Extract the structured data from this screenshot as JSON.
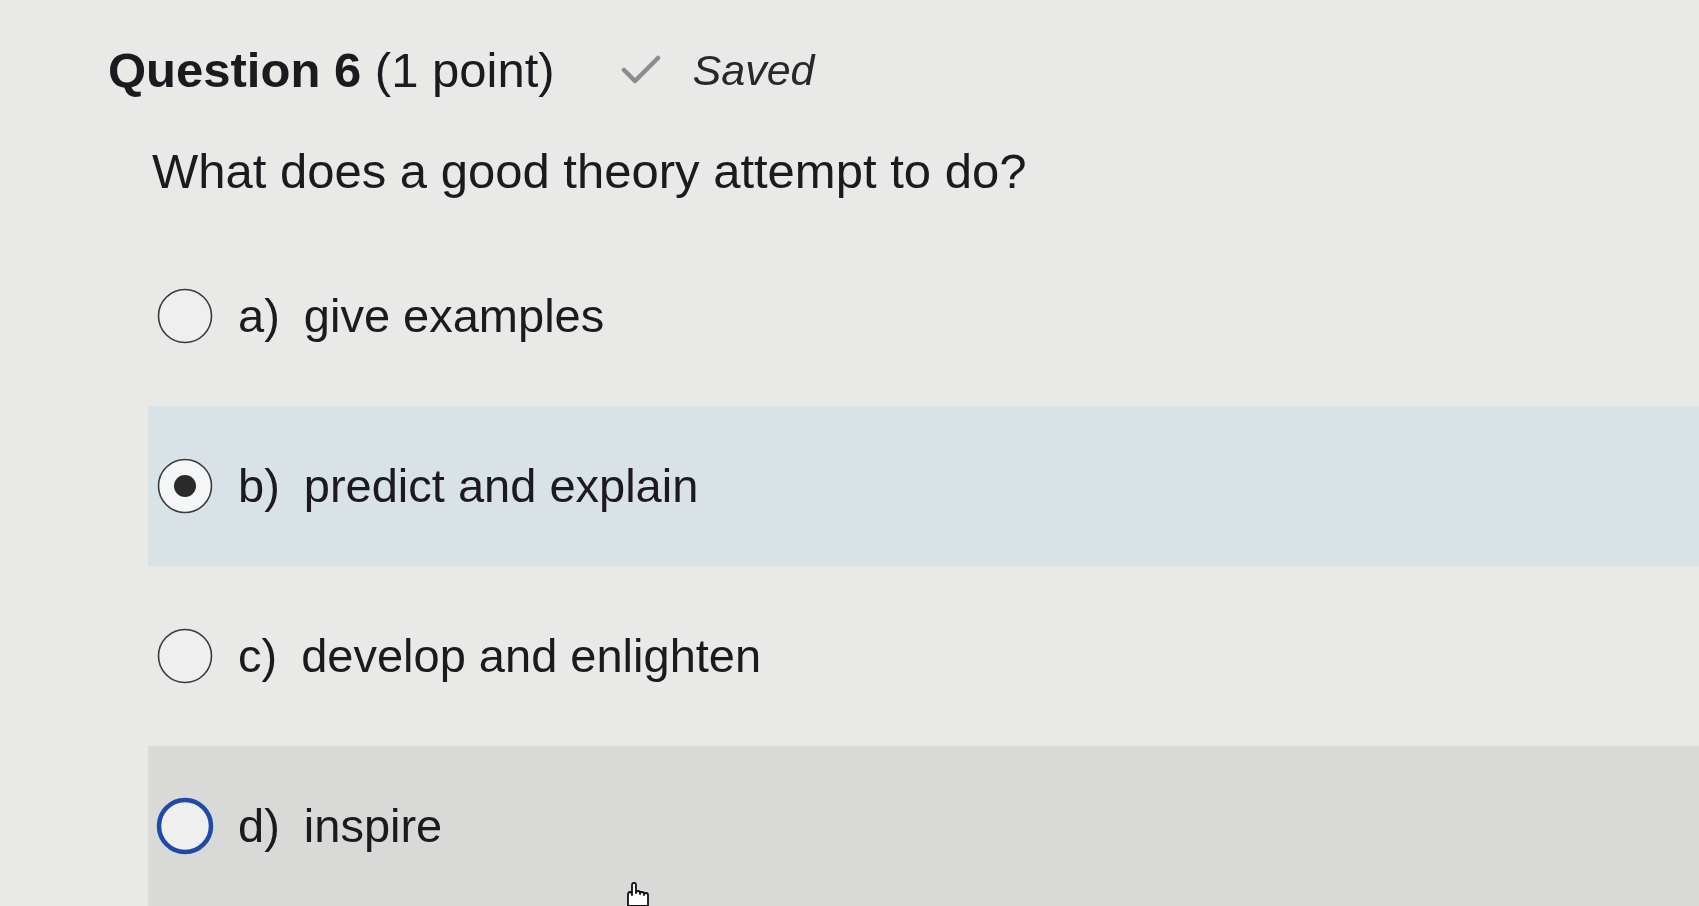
{
  "question": {
    "title": "**Question 6** (1 point)",
    "status": "Saved",
    "text": "What does a good theory attempt to do?"
  },
  "options": [
    {
      "letter": "a)",
      "text": "give examples",
      "selected": false,
      "hovered": false,
      "focused": false
    },
    {
      "letter": "b)",
      "text": "predict and explain",
      "selected": true,
      "hovered": false,
      "focused": false
    },
    {
      "letter": "c)",
      "text": "develop and enlighten",
      "selected": false,
      "hovered": false,
      "focused": false
    },
    {
      "letter": "d)",
      "text": "inspire",
      "selected": false,
      "hovered": true,
      "focused": true
    }
  ]
}
